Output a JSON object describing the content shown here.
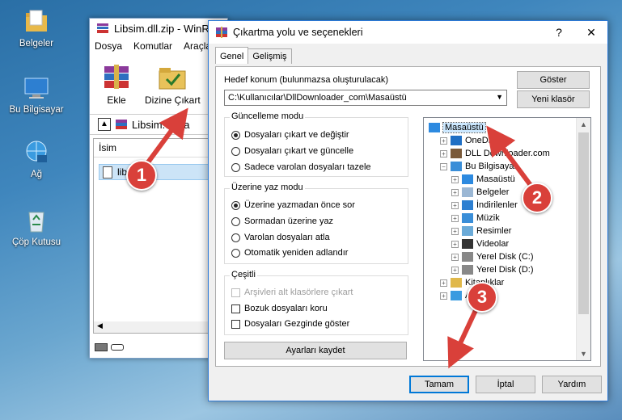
{
  "desktop": {
    "icons": [
      {
        "label": "Belgeler",
        "icon": "folder-documents-icon"
      },
      {
        "label": "Bu Bilgisayar",
        "icon": "computer-icon"
      },
      {
        "label": "Ağ",
        "icon": "network-icon"
      },
      {
        "label": "Çöp Kutusu",
        "icon": "recycle-bin-icon"
      }
    ]
  },
  "winrar": {
    "title": "Libsim.dll.zip - WinR",
    "menu": [
      "Dosya",
      "Komutlar",
      "Araçla"
    ],
    "tools": [
      {
        "label": "Ekle"
      },
      {
        "label": "Dizine Çıkart"
      }
    ],
    "address": "Libsim.dll.za",
    "column_name": "İsim",
    "file": "libsi"
  },
  "dialog": {
    "title": "Çıkartma yolu ve seçenekleri",
    "help": "?",
    "close": "✕",
    "tabs": [
      "Genel",
      "Gelişmiş"
    ],
    "dest_label": "Hedef konum (bulunmazsa oluşturulacak)",
    "dest_value": "C:\\Kullanıcılar\\DllDownloader_com\\Masaüstü",
    "show_button": "Göster",
    "new_folder_button": "Yeni klasör",
    "update_mode": {
      "title": "Güncelleme modu",
      "options": [
        "Dosyaları çıkart ve değiştir",
        "Dosyaları çıkart ve güncelle",
        "Sadece varolan dosyaları tazele"
      ],
      "selected": 0
    },
    "overwrite_mode": {
      "title": "Üzerine yaz modu",
      "options": [
        "Üzerine yazmadan önce sor",
        "Sormadan üzerine yaz",
        "Varolan dosyaları atla",
        "Otomatik yeniden adlandır"
      ],
      "selected": 0
    },
    "misc": {
      "title": "Çeşitli",
      "options": [
        {
          "label": "Arşivleri alt klasörlere çıkart",
          "checked": false,
          "disabled": true
        },
        {
          "label": "Bozuk dosyaları koru",
          "checked": false,
          "disabled": false
        },
        {
          "label": "Dosyaları Gezginde göster",
          "checked": false,
          "disabled": false
        }
      ]
    },
    "save_settings": "Ayarları kaydet",
    "tree": [
      {
        "label": "Masaüstü",
        "icon": "desktop-folder-icon",
        "selected": true,
        "expander": ""
      },
      {
        "label": "OneDrive",
        "icon": "onedrive-icon",
        "expander": "+"
      },
      {
        "label": "DLL Downloader.com",
        "icon": "user-folder-icon",
        "expander": "+"
      },
      {
        "label": "Bu Bilgisayar",
        "icon": "computer-icon",
        "expander": "−"
      },
      {
        "label": "Masaüstü",
        "icon": "desktop-folder-icon",
        "expander": "+"
      },
      {
        "label": "Belgeler",
        "icon": "documents-icon",
        "expander": "+"
      },
      {
        "label": "İndirilenler",
        "icon": "downloads-icon",
        "expander": "+"
      },
      {
        "label": "Müzik",
        "icon": "music-icon",
        "expander": "+"
      },
      {
        "label": "Resimler",
        "icon": "pictures-icon",
        "expander": "+"
      },
      {
        "label": "Videolar",
        "icon": "videos-icon",
        "expander": "+"
      },
      {
        "label": "Yerel Disk (C:)",
        "icon": "drive-icon",
        "expander": "+"
      },
      {
        "label": "Yerel Disk (D:)",
        "icon": "drive-icon",
        "expander": "+"
      },
      {
        "label": "Kitaplıklar",
        "icon": "libraries-icon",
        "expander": "+"
      },
      {
        "label": "Ağ",
        "icon": "network-icon",
        "expander": "+"
      }
    ],
    "ok_button": "Tamam",
    "cancel_button": "İptal",
    "help_button": "Yardım"
  },
  "annotations": {
    "steps": [
      "1",
      "2",
      "3"
    ],
    "color": "#d9403a"
  }
}
